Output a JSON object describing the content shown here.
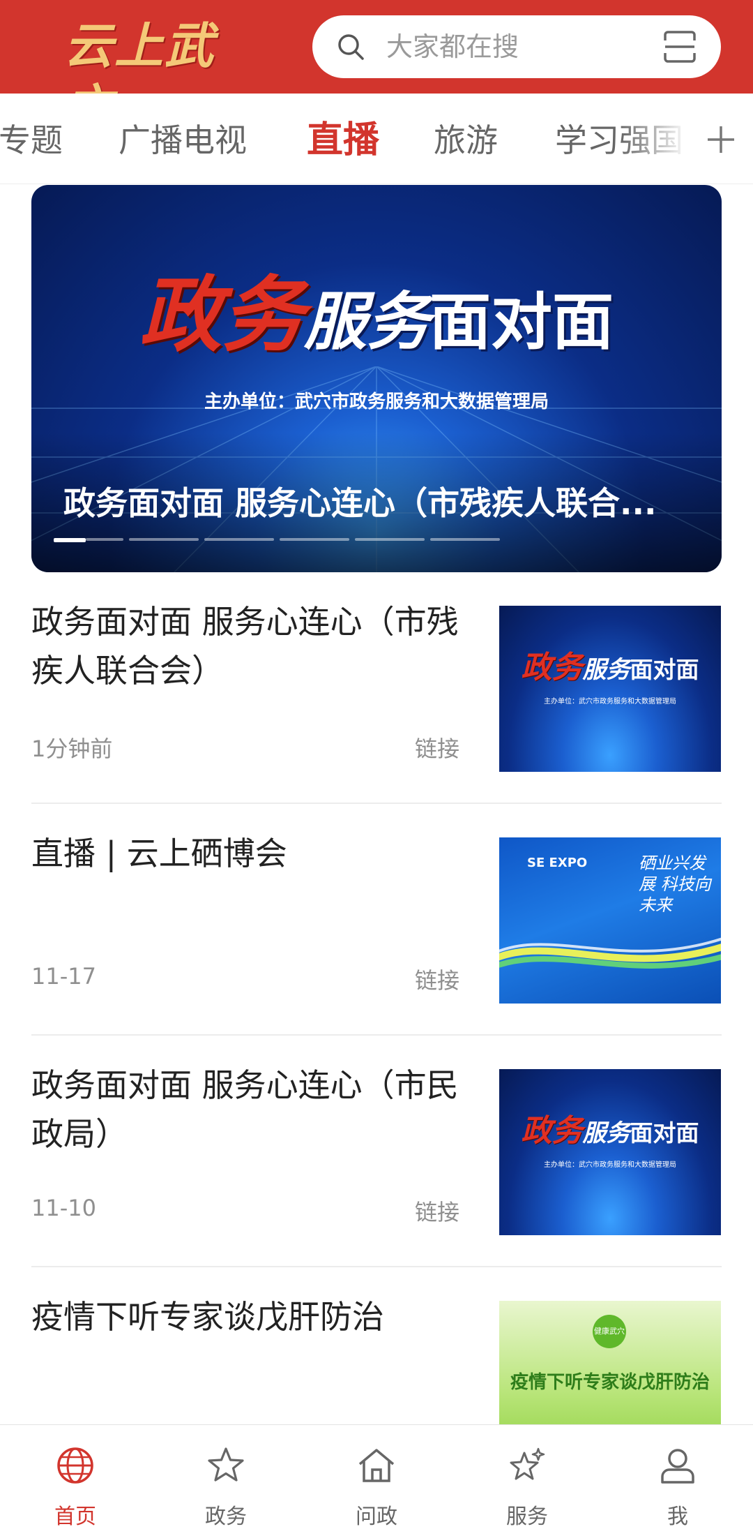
{
  "header": {
    "logo_text": "云上武穴",
    "search_placeholder": "大家都在搜",
    "icons": {
      "search": "search-icon",
      "scan": "scan-icon"
    },
    "brand_color": "#d2352d"
  },
  "tabs": [
    {
      "label": "专题",
      "active": false
    },
    {
      "label": "广播电视",
      "active": false
    },
    {
      "label": "直播",
      "active": true
    },
    {
      "label": "旅游",
      "active": false
    },
    {
      "label": "学习强国",
      "active": false
    }
  ],
  "banner": {
    "title_red": "政务",
    "title_serif": "服务",
    "title_white": "面对面",
    "org": "主办单位：武穴市政务服务和大数据管理局",
    "caption": "政务面对面 服务心连心（市残疾人联合...",
    "slides": 6,
    "active_slide": 1
  },
  "news": [
    {
      "title": "政务面对面 服务心连心（市残疾人联合会）",
      "time": "1分钟前",
      "type": "链接",
      "thumb": {
        "kind": "gov",
        "red": "政务",
        "serif": "服务",
        "white": "面对面",
        "org": "主办单位：武穴市政务服务和大数据管理局"
      }
    },
    {
      "title": "直播 | 云上硒博会",
      "time": "11-17",
      "type": "链接",
      "thumb": {
        "kind": "expo",
        "brand": "SE EXPO",
        "slogan": "硒业兴发展 科技向未来"
      }
    },
    {
      "title": "政务面对面 服务心连心（市民政局）",
      "time": "11-10",
      "type": "链接",
      "thumb": {
        "kind": "gov",
        "red": "政务",
        "serif": "服务",
        "white": "面对面",
        "org": "主办单位：武穴市政务服务和大数据管理局"
      }
    },
    {
      "title": "疫情下听专家谈戊肝防治",
      "time": "",
      "type": "",
      "thumb": {
        "kind": "health",
        "badge": "健康武穴",
        "title": "疫情下听专家谈戊肝防治"
      }
    }
  ],
  "bottom_nav": [
    {
      "label": "首页",
      "icon": "globe-icon",
      "active": true
    },
    {
      "label": "政务",
      "icon": "star-icon",
      "active": false
    },
    {
      "label": "问政",
      "icon": "home-icon",
      "active": false
    },
    {
      "label": "服务",
      "icon": "sparkle-star-icon",
      "active": false
    },
    {
      "label": "我",
      "icon": "user-icon",
      "active": false
    }
  ]
}
